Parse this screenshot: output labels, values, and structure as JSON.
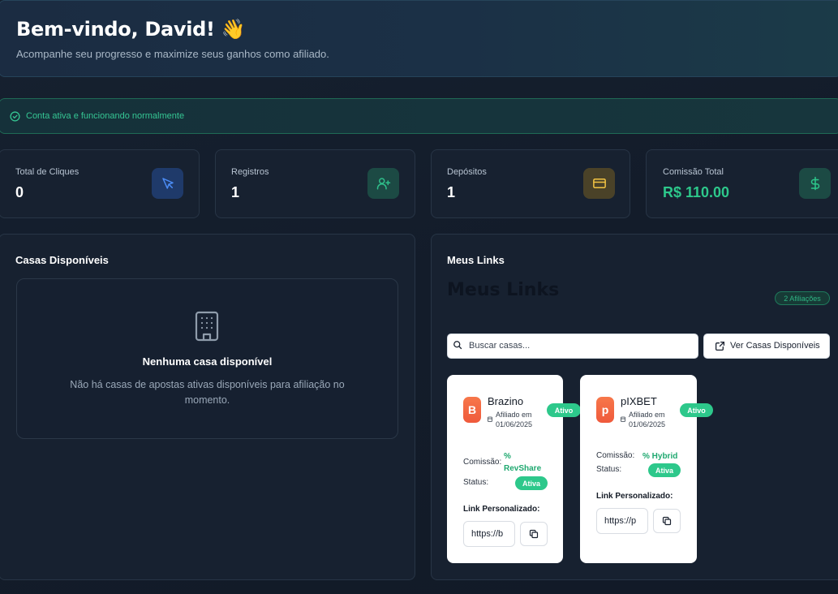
{
  "welcome": {
    "title": "Bem-vindo, David! 👋",
    "subtitle": "Acompanhe seu progresso e maximize seus ganhos como afiliado."
  },
  "status": {
    "text": "Conta ativa e funcionando normalmente",
    "icon": "check-circle-icon",
    "color": "#35c693"
  },
  "stats": [
    {
      "label": "Total de Cliques",
      "value": "0",
      "icon": "cursor-icon",
      "accent": "#3b82f6"
    },
    {
      "label": "Registros",
      "value": "1",
      "icon": "user-plus-icon",
      "accent": "#2fbf8a"
    },
    {
      "label": "Depósitos",
      "value": "1",
      "icon": "credit-card-icon",
      "accent": "#f2c443"
    },
    {
      "label": "Comissão Total",
      "value": "R$ 110.00",
      "icon": "dollar-icon",
      "accent": "#2dc88b"
    }
  ],
  "houses_panel": {
    "title": "Casas Disponíveis",
    "empty_title": "Nenhuma casa disponível",
    "empty_desc": "Não há casas de apostas ativas disponíveis para afiliação no momento.",
    "empty_icon": "building-icon"
  },
  "links_panel": {
    "title": "Meus Links",
    "big_title": "Meus Links",
    "badge": "2 Afiliações",
    "search_placeholder": "Buscar casas...",
    "ver_button": "Ver Casas Disponíveis"
  },
  "affiliations": [
    {
      "logo": "B",
      "name": "Brazino",
      "status_pill": "Ativo",
      "affiliated_line1": "Afiliado em",
      "affiliated_line2": "01/06/2025",
      "commission_label": "Comissão:",
      "commission_line1": "%",
      "commission_line2": "RevShare",
      "status_label": "Status:",
      "status_value": "Ativa",
      "link_label": "Link Personalizado:",
      "link_value": "https://b"
    },
    {
      "logo": "p",
      "name": "pIXBET",
      "status_pill": "Ativo",
      "affiliated_line1": "Afiliado em",
      "affiliated_line2": "01/06/2025",
      "commission_label": "Comissão:",
      "commission_value": "% Hybrid",
      "status_label": "Status:",
      "status_value": "Ativa",
      "link_label": "Link Personalizado:",
      "link_value": "https://p"
    }
  ]
}
